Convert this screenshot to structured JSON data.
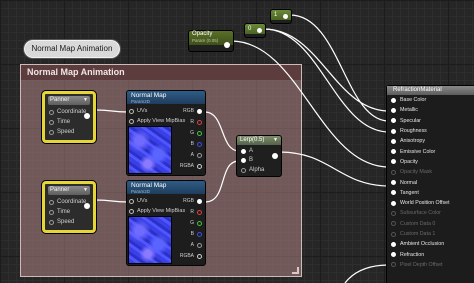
{
  "bubble_label": "Normal Map Animation",
  "comment_title": "Normal Map Animation",
  "panner_nodes": [
    {
      "title": "Panner",
      "pins": [
        "Coordinate",
        "Time",
        "Speed"
      ]
    },
    {
      "title": "Panner",
      "pins": [
        "Coordinate",
        "Time",
        "Speed"
      ]
    }
  ],
  "texture_nodes": [
    {
      "title": "Normal Map",
      "subtitle": "Param2D",
      "input_uvs": "UVs",
      "input_mip": "Apply View MipBias",
      "outputs": [
        "RGB",
        "R",
        "G",
        "B",
        "A",
        "RGBA"
      ]
    },
    {
      "title": "Normal Map",
      "subtitle": "Param2D",
      "input_uvs": "UVs",
      "input_mip": "Apply View MipBias",
      "outputs": [
        "RGB",
        "R",
        "G",
        "B",
        "A",
        "RGBA"
      ]
    }
  ],
  "lerp_node": {
    "title": "Lerp(0.5)",
    "inputs": [
      "A",
      "B",
      "Alpha"
    ]
  },
  "opacity_node": {
    "title": "Opacity",
    "subtitle": "Param (0.05)"
  },
  "constant_nodes": [
    {
      "value": "0"
    },
    {
      "value": "1"
    }
  ],
  "material_node": {
    "title": "RefractionMaterial",
    "inputs": [
      {
        "label": "Base Color",
        "active": true
      },
      {
        "label": "Metallic",
        "active": true
      },
      {
        "label": "Specular",
        "active": true
      },
      {
        "label": "Roughness",
        "active": true
      },
      {
        "label": "Anisotropy",
        "active": true
      },
      {
        "label": "Emissive Color",
        "active": true
      },
      {
        "label": "Opacity",
        "active": true
      },
      {
        "label": "Opacity Mask",
        "active": false
      },
      {
        "label": "Normal",
        "active": true
      },
      {
        "label": "Tangent",
        "active": true
      },
      {
        "label": "World Position Offset",
        "active": true
      },
      {
        "label": "Subsurface Color",
        "active": false
      },
      {
        "label": "Custom Data 0",
        "active": false
      },
      {
        "label": "Custom Data 1",
        "active": false
      },
      {
        "label": "Ambient Occlusion",
        "active": true
      },
      {
        "label": "Refraction",
        "active": true
      },
      {
        "label": "Pixel Depth Offset",
        "active": false
      }
    ]
  },
  "colors": {
    "selection": "#e6d538",
    "texture_header": "#2f5c86",
    "comment_header": "#5c3c3c",
    "pin_r": "#e04040",
    "pin_g": "#3cc83c",
    "pin_b": "#3c50e0"
  }
}
